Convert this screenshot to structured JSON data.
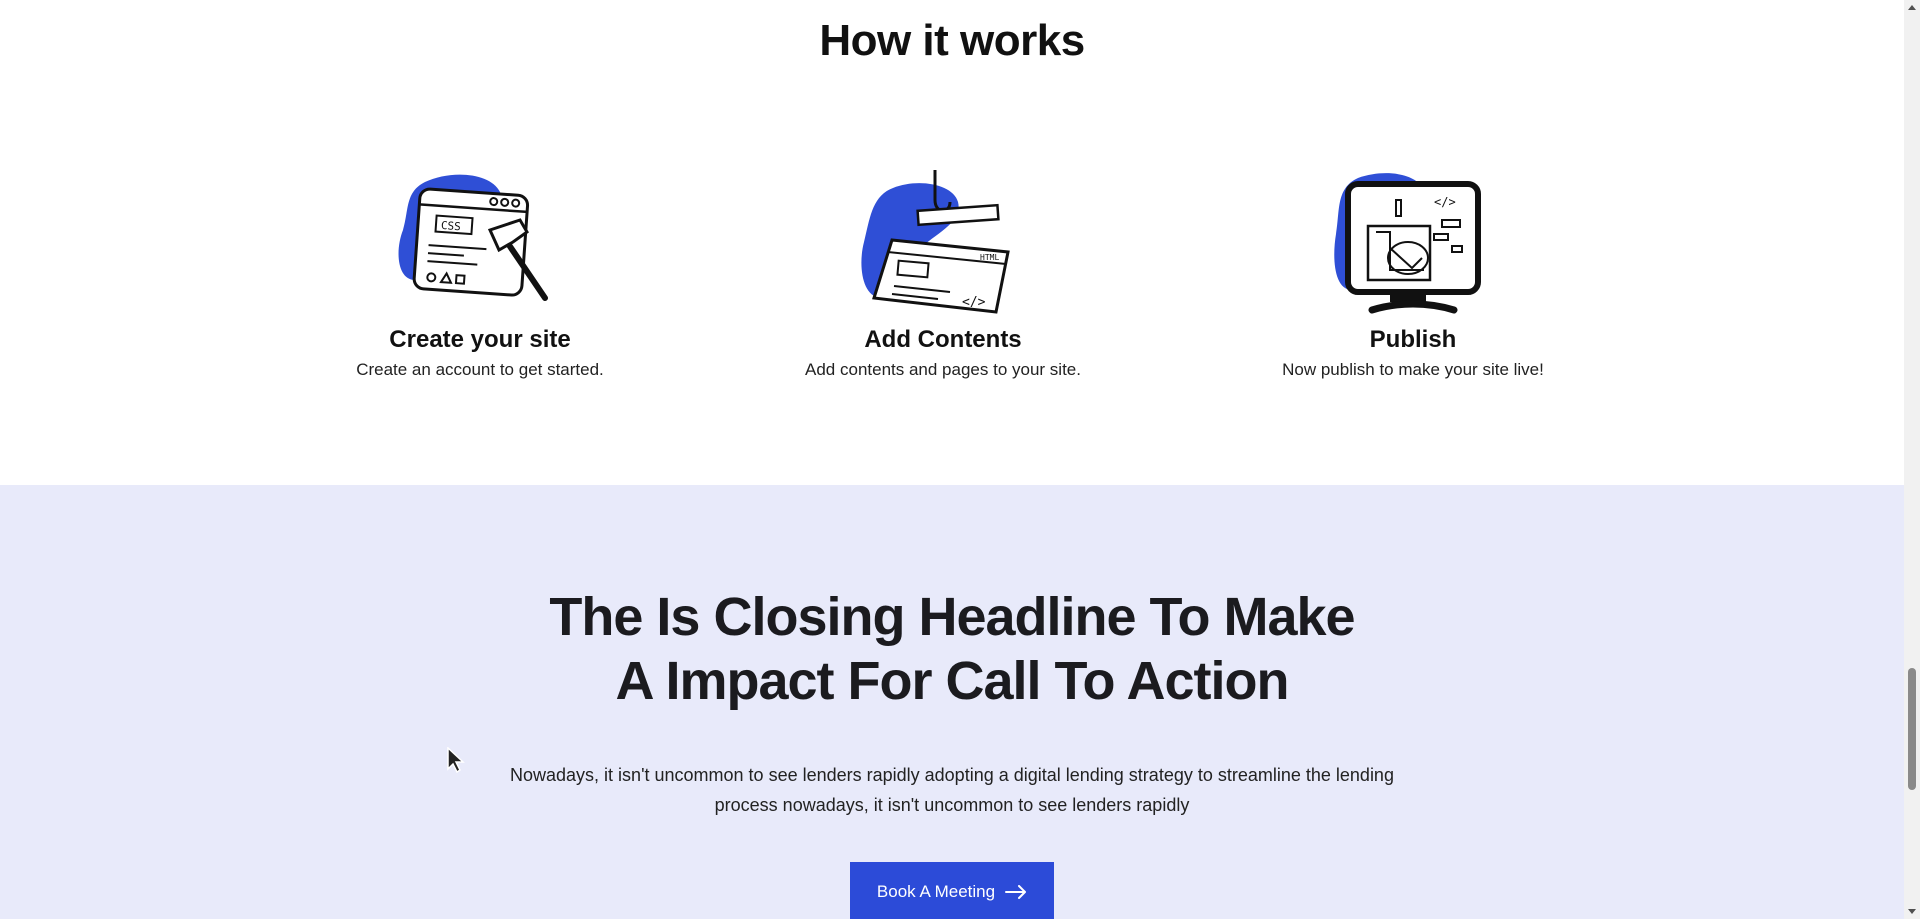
{
  "how_it_works": {
    "title": "How it works",
    "steps": [
      {
        "title": "Create your site",
        "description": "Create an account to get started.",
        "icon": "browser-hammer-illustration"
      },
      {
        "title": "Add Contents",
        "description": "Add contents and pages to your site.",
        "icon": "html-page-hook-illustration"
      },
      {
        "title": "Publish",
        "description": "Now publish to make your site live!",
        "icon": "monitor-publish-illustration"
      }
    ]
  },
  "cta": {
    "headline_line1": "The Is Closing Headline To Make",
    "headline_line2": "A Impact For Call To Action",
    "body": "Nowadays, it isn't uncommon to see lenders rapidly adopting a digital lending strategy to streamline the lending process nowadays, it isn't uncommon to see lenders rapidly",
    "button_label": "Book A Meeting",
    "button_icon": "arrow-right-icon"
  },
  "illustration_text": {
    "css_label": "CSS",
    "code_tag": "</>",
    "html_label": "HTML"
  },
  "colors": {
    "accent": "#2c4bd8",
    "illustration_blob": "#2f4fd6",
    "cta_background": "#e8eafa",
    "heading": "#111111"
  }
}
